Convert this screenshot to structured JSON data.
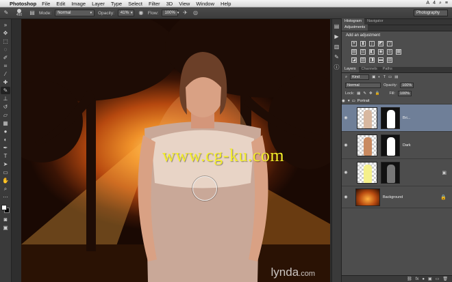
{
  "menubar": {
    "app_name": "Photoshop",
    "items": [
      "File",
      "Edit",
      "Image",
      "Layer",
      "Type",
      "Select",
      "Filter",
      "3D",
      "View",
      "Window",
      "Help"
    ],
    "status_icons": [
      "A",
      "4"
    ]
  },
  "options": {
    "brush_size": "450",
    "mode_label": "Mode:",
    "mode_value": "Normal",
    "opacity_label": "Opacity:",
    "opacity_value": "41%",
    "flow_label": "Flow:",
    "flow_value": "100%",
    "workspace": "Photography"
  },
  "canvas": {
    "watermark": "www.cg-ku.com",
    "lynda_logo": "lynda",
    "lynda_suffix": ".com"
  },
  "panels": {
    "top_tabs": [
      "Histogram",
      "Navigator"
    ],
    "adjustments_tab": "Adjustments",
    "add_adjustment": "Add an adjustment",
    "layer_tabs": [
      "Layers",
      "Channels",
      "Paths"
    ],
    "kind_filter": "Kind",
    "blend_mode": "Normal",
    "opacity_label": "Opacity:",
    "opacity_value": "100%",
    "lock_label": "Lock:",
    "fill_label": "Fill:",
    "fill_value": "100%",
    "group_name": "Portrait",
    "layers": [
      {
        "name": "Bri...",
        "selected": true
      },
      {
        "name": "Dark",
        "selected": false
      },
      {
        "name": "",
        "selected": false
      },
      {
        "name": "Background",
        "selected": false
      }
    ],
    "footer_icons": [
      "fx",
      "●",
      "▣",
      "▭",
      "🗑"
    ]
  },
  "colors": {
    "selection": "#6f7f98",
    "watermark": "#f5ef2a",
    "panel_bg": "#4d4d4d"
  }
}
